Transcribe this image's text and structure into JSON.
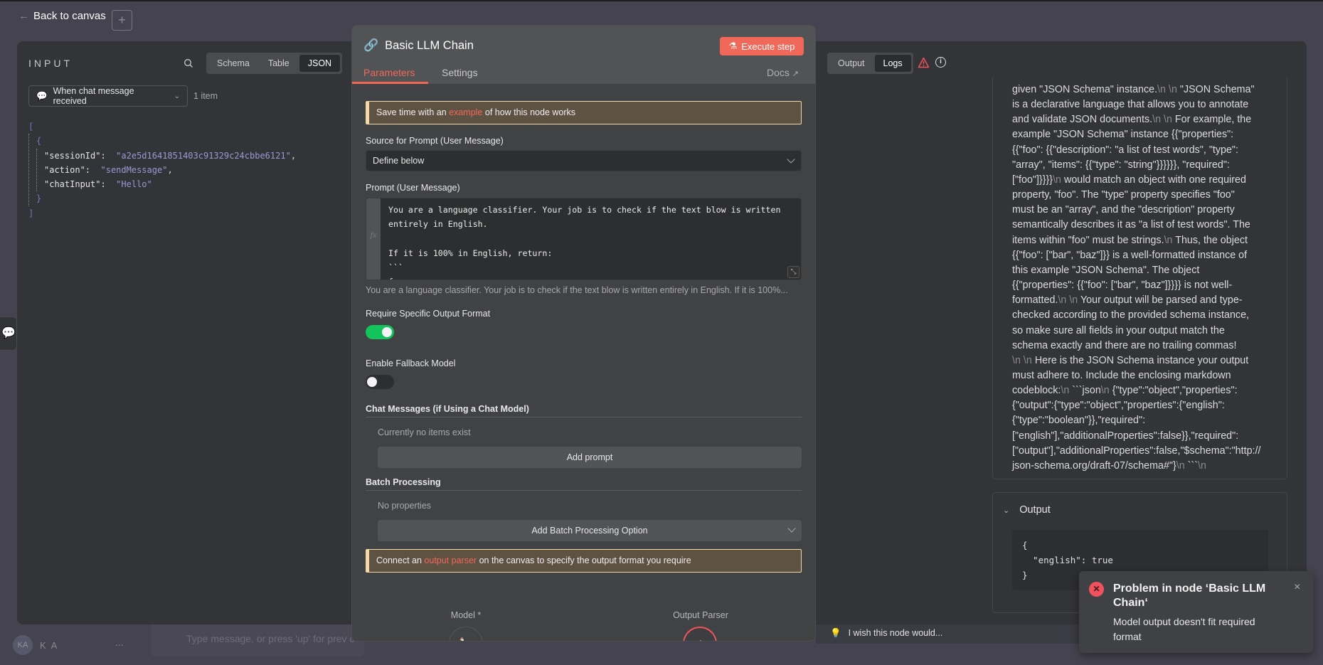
{
  "nav": {
    "back_label": "Back to canvas",
    "add_label": "+"
  },
  "input": {
    "title": "INPUT",
    "views": [
      "Schema",
      "Table",
      "JSON"
    ],
    "active_view": "JSON",
    "source_node": "When chat message received",
    "item_count": "1 item",
    "json": {
      "sessionId": "a2e5d1641851403c91329c24cbbe6121",
      "action": "sendMessage",
      "chatInput": "Hello"
    }
  },
  "user": {
    "initials": "KA",
    "name": "K A",
    "more": "..."
  },
  "chat": {
    "placeholder": "Type message, or press 'up' for prev c"
  },
  "node": {
    "title": "Basic LLM Chain",
    "execute_label": "Execute step",
    "tabs": [
      "Parameters",
      "Settings"
    ],
    "active_tab": "Parameters",
    "docs_label": "Docs",
    "example_notice": {
      "before": "Save time with an ",
      "link": "example",
      "after": " of how this node works"
    },
    "source_label": "Source for Prompt (User Message)",
    "source_value": "Define below",
    "prompt_label": "Prompt (User Message)",
    "prompt_lines": [
      "You are a language classifier. Your job is to check if the text blow is written",
      "entirely in English.",
      "",
      "If it is 100% in English, return:",
      "```",
      "{"
    ],
    "prompt_preview": "You are a language classifier. Your job is to check if the text blow is written entirely in English. If it is 100%...",
    "require_format_label": "Require Specific Output Format",
    "require_format_on": true,
    "fallback_label": "Enable Fallback Model",
    "fallback_on": false,
    "chat_messages_label": "Chat Messages (if Using a Chat Model)",
    "chat_messages_empty": "Currently no items exist",
    "add_prompt_label": "Add prompt",
    "batch_label": "Batch Processing",
    "batch_empty": "No properties",
    "add_batch_label": "Add Batch Processing Option",
    "parser_notice": {
      "before": "Connect an ",
      "link": "output parser",
      "after": " on the canvas to specify the output format you require"
    },
    "model_label": "Model *",
    "parser_label": "Output Parser"
  },
  "output": {
    "views": [
      "Output",
      "Logs"
    ],
    "active_view": "Logs",
    "log_lines": [
      "given \"JSON Schema\" instance.\\n \\n \"JSON Schema\"",
      "is a declarative language that allows you to annotate",
      "and validate JSON documents.\\n \\n For example, the",
      "example \"JSON Schema\" instance {{\"properties\":",
      "{{\"foo\": {{\"description\": \"a list of test words\", \"type\":",
      "\"array\", \"items\": {{\"type\": \"string\"}}}}}}, \"required\":",
      "[\"foo\"]}}}}\\n would match an object with one required",
      "property, \"foo\". The \"type\" property specifies \"foo\"",
      "must be an \"array\", and the \"description\" property",
      "semantically describes it as \"a list of test words\". The",
      "items within \"foo\" must be strings.\\n Thus, the object",
      "{{\"foo\": [\"bar\", \"baz\"]}} is a well-formatted instance of",
      "this example \"JSON Schema\". The object",
      "{{\"properties\": {{\"foo\": [\"bar\", \"baz\"]}}}} is not well-",
      "formatted.\\n \\n Your output will be parsed and type-",
      "checked according to the provided schema instance,",
      "so make sure all fields in your output match the",
      "schema exactly and there are no trailing commas!",
      "\\n \\n Here is the JSON Schema instance your output",
      "must adhere to. Include the enclosing markdown",
      "codeblock:\\n ```json\\n {\"type\":\"object\",\"properties\":",
      "{\"output\":{\"type\":\"object\",\"properties\":{\"english\":",
      "{\"type\":\"boolean\"}},\"required\":",
      "[\"english\"],\"additionalProperties\":false}},\"required\":",
      "[\"output\"],\"additionalProperties\":false,\"$schema\":\"http://",
      "json-schema.org/draft-07/schema#\"}\\n ```\\n"
    ],
    "output_section_label": "Output",
    "output_code": "{\n  \"english\": true\n}",
    "feedback_placeholder": "I wish this node would..."
  },
  "toast": {
    "title": "Problem in node ‘Basic LLM Chain‘",
    "message": "Model output doesn't fit required format",
    "close": "×"
  },
  "colors": {
    "accent": "#f0685a",
    "toggle_on": "#13c45c",
    "error": "#f0535d",
    "notice_bg": "#5e5243",
    "notice_border": "#f3d9a6"
  }
}
